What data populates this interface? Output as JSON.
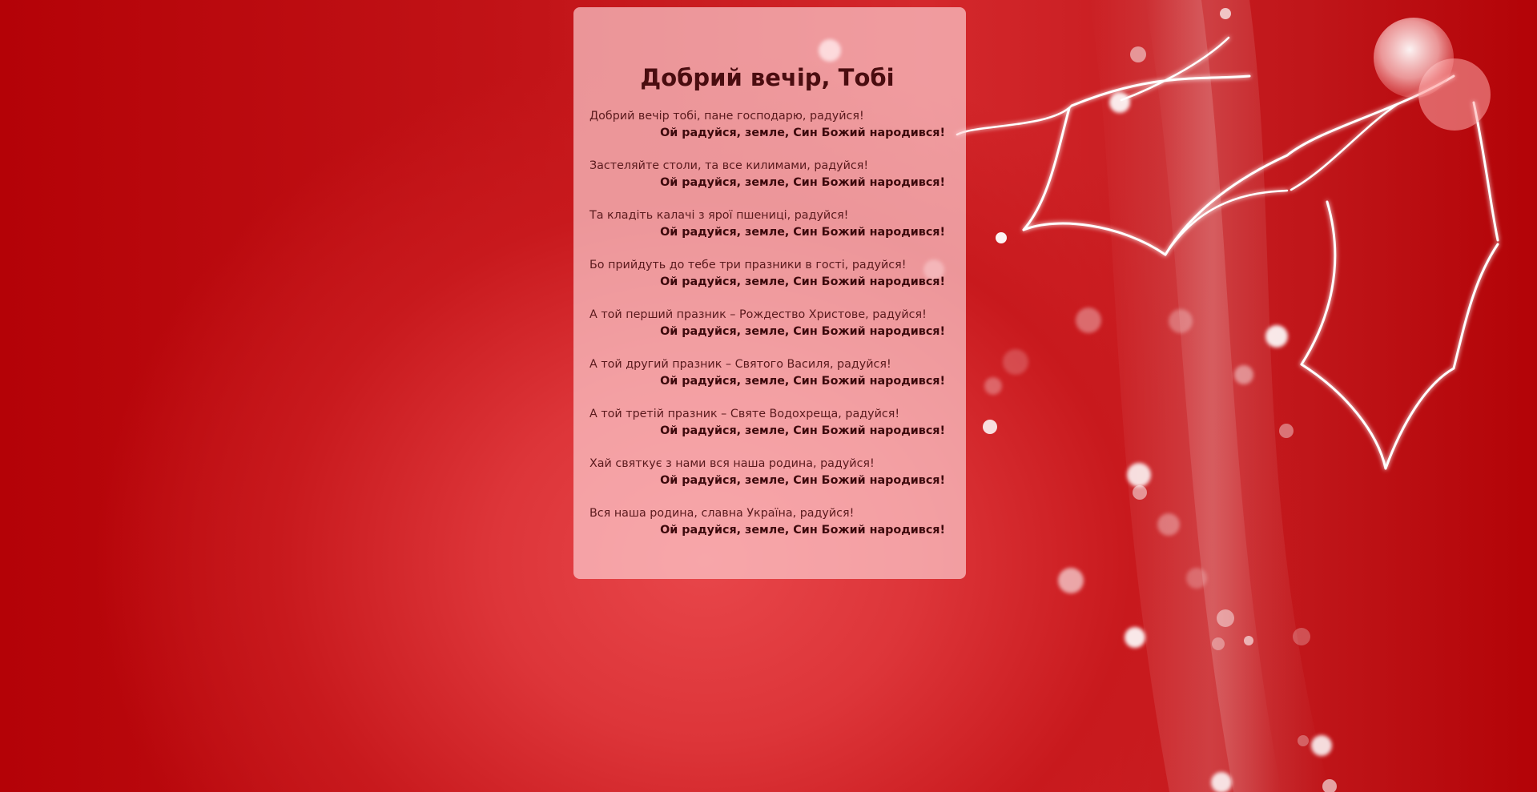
{
  "page": {
    "title": "Добрий вечір, Тобі",
    "background_color": "#b40207",
    "card_color": "#f1b3b5"
  },
  "song": {
    "verses": [
      {
        "line": "Добрий вечір тобі, пане господарю, радуйся!",
        "refrain": "Ой радуйся, земле, Син Божий народився!"
      },
      {
        "line": "Застеляйте столи, та все килимами, радуйся!",
        "refrain": "Ой радуйся, земле, Син Божий народився!"
      },
      {
        "line": "Та кладіть калачі з ярої пшениці, радуйся!",
        "refrain": "Ой радуйся, земле, Син Божий народився!"
      },
      {
        "line": "Бо прийдуть до тебе три празники в гості, радуйся!",
        "refrain": "Ой радуйся, земле, Син Божий народився!"
      },
      {
        "line": "А той перший празник – Рождество Христове, радуйся!",
        "refrain": "Ой радуйся, земле, Син Божий народився!"
      },
      {
        "line": "А той другий празник – Святого Василя, радуйся!",
        "refrain": "Ой радуйся, земле, Син Божий народився!"
      },
      {
        "line": "А той третій празник – Святе Водохреща, радуйся!",
        "refrain": "Ой радуйся, земле, Син Божий народився!"
      },
      {
        "line": "Хай святкує з нами вся наша родина, радуйся!",
        "refrain": "Ой радуйся, земле, Син Божий народився!"
      },
      {
        "line": "Вся наша родина, славна Україна, радуйся!",
        "refrain": "Ой радуйся, земле, Син Божий народився!"
      }
    ]
  }
}
